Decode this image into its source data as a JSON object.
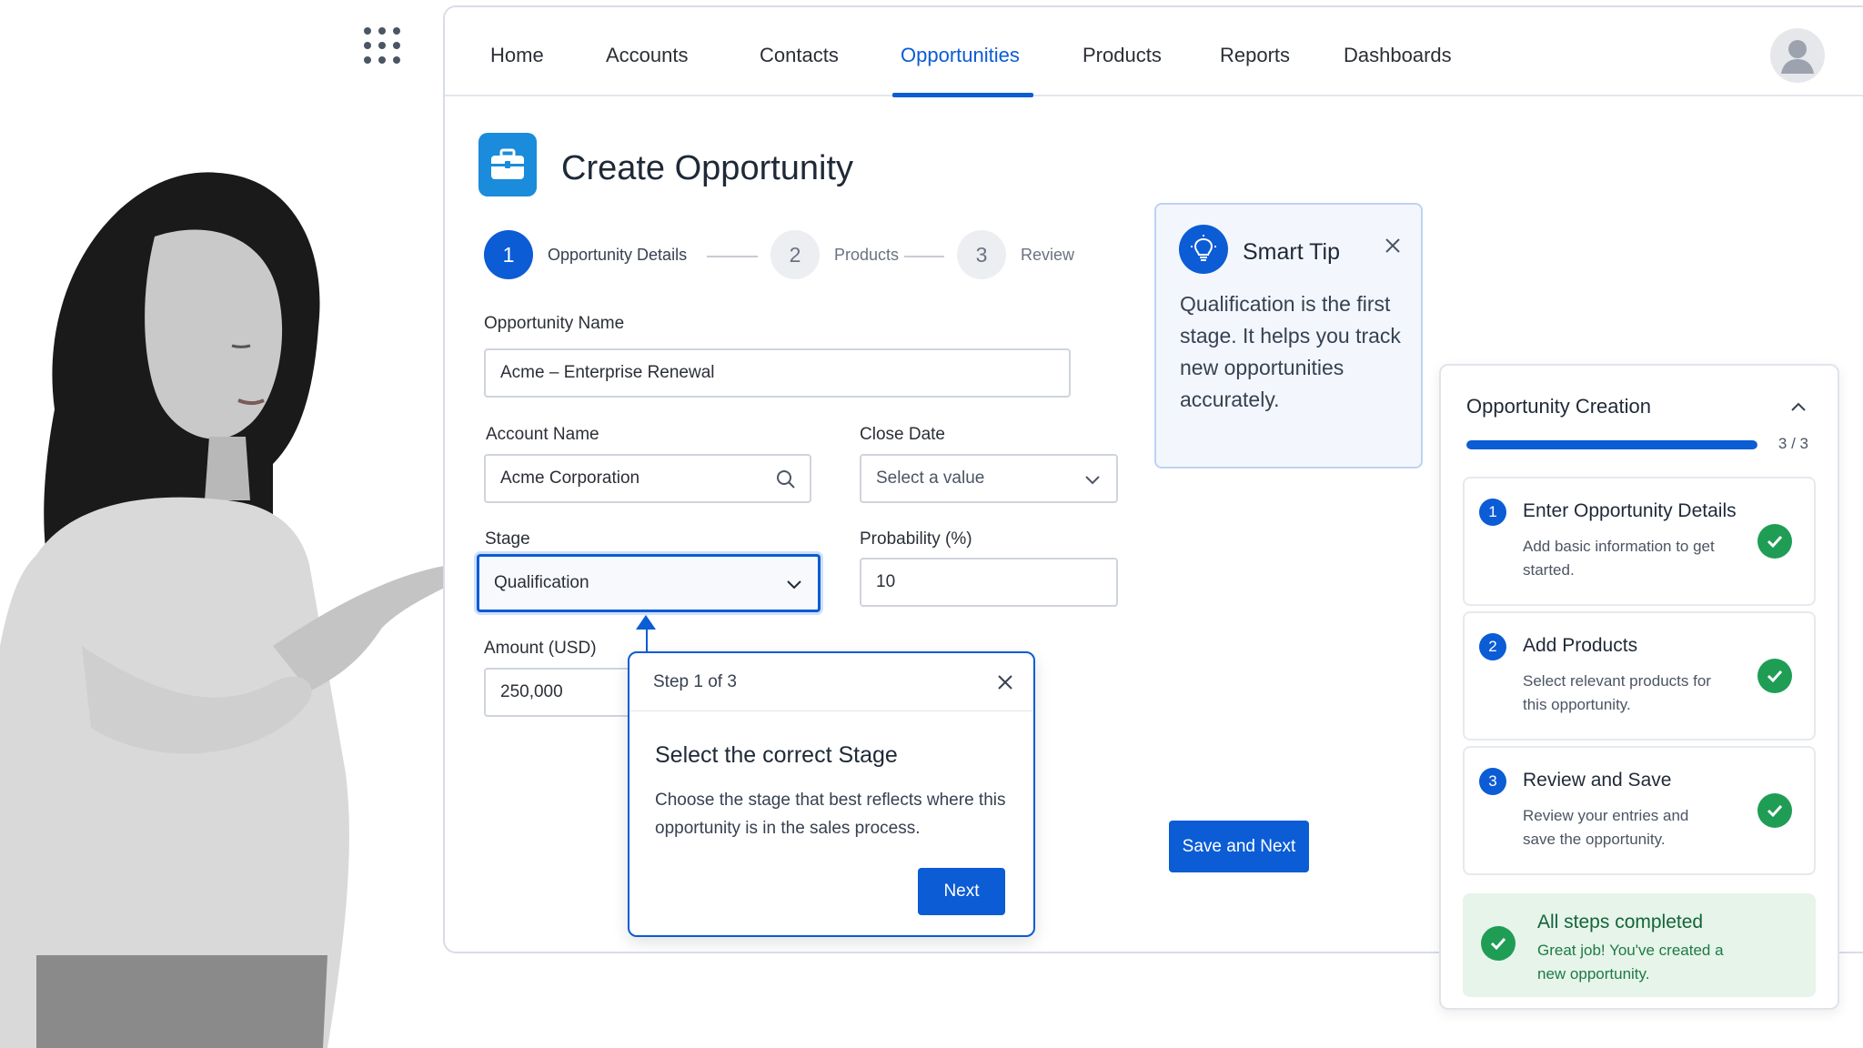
{
  "nav": {
    "items": [
      {
        "label": "Home",
        "active": false
      },
      {
        "label": "Accounts",
        "active": false
      },
      {
        "label": "Contacts",
        "active": false
      },
      {
        "label": "Opportunities",
        "active": true
      },
      {
        "label": "Products",
        "active": false
      },
      {
        "label": "Reports",
        "active": false
      },
      {
        "label": "Dashboards",
        "active": false
      }
    ]
  },
  "page": {
    "title": "Create Opportunity",
    "icon": "briefcase-icon"
  },
  "stepper": [
    {
      "number": "1",
      "label": "Opportunity Details",
      "active": true
    },
    {
      "number": "2",
      "label": "Products",
      "active": false
    },
    {
      "number": "3",
      "label": "Review",
      "active": false
    }
  ],
  "form": {
    "opportunity_name": {
      "label": "Opportunity Name",
      "value": "Acme – Enterprise Renewal"
    },
    "account_name": {
      "label": "Account Name",
      "value": "Acme Corporation"
    },
    "close_date": {
      "label": "Close Date",
      "placeholder": "Select a value"
    },
    "stage": {
      "label": "Stage",
      "value": "Qualification"
    },
    "probability": {
      "label": "Probability (%)",
      "value": "10"
    },
    "amount": {
      "label": "Amount (USD)",
      "value": "250,000"
    },
    "save_button": "Save and Next"
  },
  "tour": {
    "step": "Step 1 of 3",
    "title": "Select the correct Stage",
    "body": "Choose the stage that best reflects where this opportunity is in the sales process.",
    "next": "Next"
  },
  "tip": {
    "title": "Smart Tip",
    "body": "Qualification is the first stage. It helps you track new opportunities accurately."
  },
  "panel": {
    "title": "Opportunity Creation",
    "progress_text": "3 / 3",
    "progress_fraction": 1.0,
    "steps": [
      {
        "number": "1",
        "title": "Enter Opportunity Details",
        "desc": "Add basic information to get started."
      },
      {
        "number": "2",
        "title": "Add Products",
        "desc": "Select relevant products for this opportunity."
      },
      {
        "number": "3",
        "title": "Review and Save",
        "desc": "Review your entries and save the opportunity."
      }
    ],
    "done_title": "All steps completed",
    "done_desc": "Great job! You've created a new opportunity."
  },
  "colors": {
    "accent": "#0b5cd5",
    "success": "#1f9d55",
    "tip_bg": "#f3f7fd",
    "done_bg": "#e6f4ea"
  }
}
